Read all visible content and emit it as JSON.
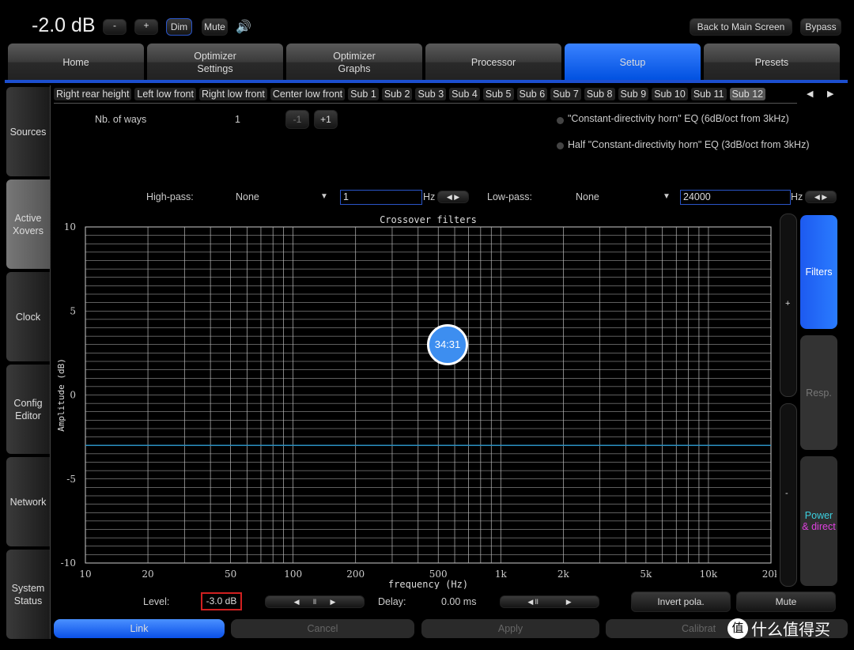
{
  "top": {
    "volume": "-2.0 dB",
    "minus": "-",
    "plus": "+",
    "dim": "Dim",
    "mute": "Mute",
    "speaker_icon": "speaker-icon",
    "back": "Back to Main Screen",
    "bypass": "Bypass"
  },
  "tabs": [
    {
      "label": "Home"
    },
    {
      "label": "Optimizer\nSettings"
    },
    {
      "label": "Optimizer\nGraphs"
    },
    {
      "label": "Processor"
    },
    {
      "label": "Setup",
      "active": true
    },
    {
      "label": "Presets"
    }
  ],
  "sidebar": [
    {
      "label": "Sources"
    },
    {
      "label": "Active\nXovers",
      "active": true
    },
    {
      "label": "Clock"
    },
    {
      "label": "Config\nEditor"
    },
    {
      "label": "Network"
    },
    {
      "label": "System\nStatus"
    }
  ],
  "channels": [
    "Right rear height",
    "Left low front",
    "Right low front",
    "Center low front",
    "Sub 1",
    "Sub 2",
    "Sub 3",
    "Sub 4",
    "Sub 5",
    "Sub 6",
    "Sub 7",
    "Sub 8",
    "Sub 9",
    "Sub 10",
    "Sub 11",
    "Sub 12"
  ],
  "selected_channel": "Sub 12",
  "ways": {
    "label": "Nb. of ways",
    "value": "1",
    "dec": "-1",
    "inc": "+1"
  },
  "eq_options": [
    "\"Constant-directivity horn\" EQ (6dB/oct from 3kHz)",
    "Half \"Constant-directivity horn\" EQ (3dB/oct from 3kHz)"
  ],
  "highpass": {
    "label": "High-pass:",
    "type": "None",
    "value": "1",
    "unit": "Hz"
  },
  "lowpass": {
    "label": "Low-pass:",
    "type": "None",
    "value": "24000",
    "unit": "Hz"
  },
  "timer": "34:31",
  "right": {
    "filters": "Filters",
    "resp": "Resp.",
    "power1": "Power",
    "power2": "& direct",
    "plus": "+",
    "minus": "-"
  },
  "bottom": {
    "level_label": "Level:",
    "level": "-3.0 dB",
    "delay_label": "Delay:",
    "delay": "0.00 ms",
    "invert": "Invert pola.",
    "mute": "Mute",
    "link": "Link",
    "cancel": "Cancel",
    "apply": "Apply",
    "calibrate": "Calibrat"
  },
  "watermark": "什么值得买",
  "chart_data": {
    "type": "line",
    "title": "Crossover filters",
    "xlabel": "frequency (Hz)",
    "ylabel": "Amplitude (dB)",
    "xscale": "log",
    "xlim": [
      10,
      20000
    ],
    "ylim": [
      -10,
      10
    ],
    "xticks": [
      {
        "v": 10,
        "l": "10"
      },
      {
        "v": 20,
        "l": "20"
      },
      {
        "v": 50,
        "l": "50"
      },
      {
        "v": 100,
        "l": "100"
      },
      {
        "v": 200,
        "l": "200"
      },
      {
        "v": 500,
        "l": "500"
      },
      {
        "v": 1000,
        "l": "1k"
      },
      {
        "v": 2000,
        "l": "2k"
      },
      {
        "v": 5000,
        "l": "5k"
      },
      {
        "v": 10000,
        "l": "10k"
      },
      {
        "v": 20000,
        "l": "20k"
      }
    ],
    "yticks": [
      {
        "v": 10,
        "l": "10"
      },
      {
        "v": 5,
        "l": "5"
      },
      {
        "v": 0,
        "l": "0"
      },
      {
        "v": -5,
        "l": "-5"
      },
      {
        "v": -10,
        "l": "-10"
      }
    ],
    "grid": true,
    "series": [
      {
        "x": [
          10,
          20000
        ],
        "y": [
          -3,
          -3
        ],
        "color": "#2a8fc0"
      }
    ]
  }
}
